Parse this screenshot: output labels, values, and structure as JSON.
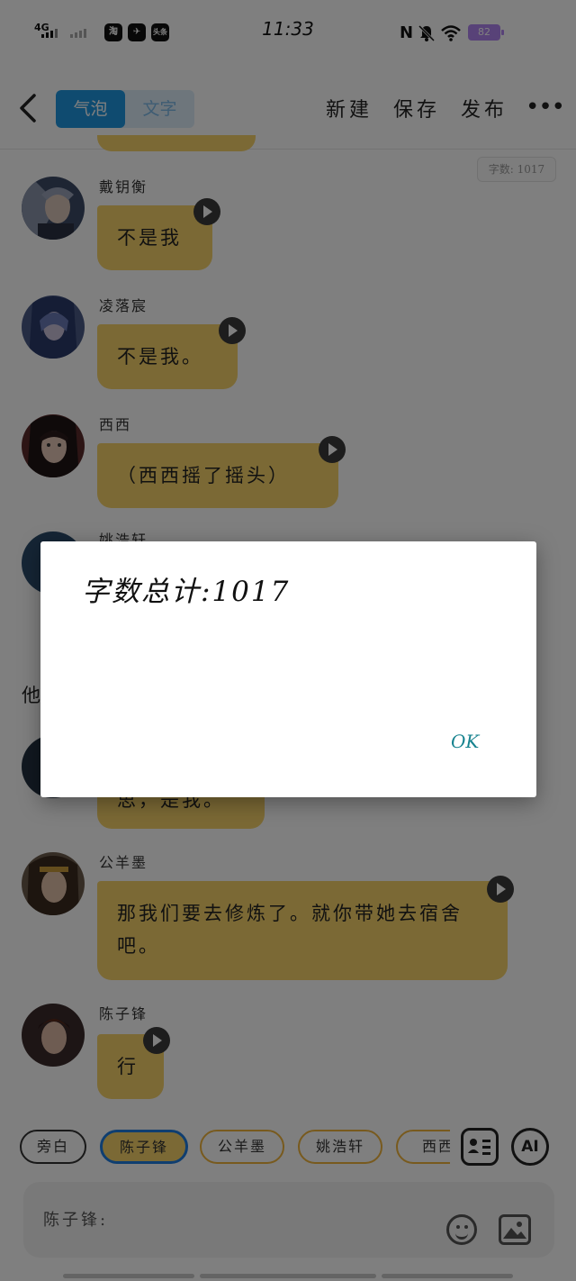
{
  "status_bar": {
    "network": "4G",
    "time": "11:33",
    "battery": "82",
    "apps": [
      "淘",
      "✈",
      "头条"
    ]
  },
  "nav": {
    "back_icon": "chevron-left-icon",
    "tabs": [
      {
        "label": "气泡",
        "active": true
      },
      {
        "label": "文字",
        "active": false
      }
    ],
    "actions": [
      "新建",
      "保存",
      "发布"
    ],
    "more": "•••"
  },
  "word_count_badge": "字数: 1017",
  "messages": [
    {
      "speaker": "戴钥衡",
      "text": "不是我"
    },
    {
      "speaker": "凌落宸",
      "text": "不是我。"
    },
    {
      "speaker": "西西",
      "text": "（西西摇了摇头）"
    },
    {
      "speaker": "姚浩轩",
      "text": ""
    },
    {
      "speaker": "",
      "text": "思，是我。"
    },
    {
      "speaker": "公羊墨",
      "text": "那我们要去修炼了。就你带她去宿舍吧。"
    },
    {
      "speaker": "陈子锋",
      "text": "行"
    }
  ],
  "narration_partial": "他",
  "chips": [
    {
      "label": "旁白",
      "kind": "narrator"
    },
    {
      "label": "陈子锋",
      "kind": "selected"
    },
    {
      "label": "公羊墨",
      "kind": "character"
    },
    {
      "label": "姚浩轩",
      "kind": "character"
    },
    {
      "label": "西西",
      "kind": "character"
    }
  ],
  "tools": {
    "ai_label": "AI",
    "roles_icon": "contact-card-icon"
  },
  "input": {
    "value": "陈子锋:"
  },
  "dialog": {
    "message": "字数总计:1017",
    "ok_label": "OK"
  },
  "colors": {
    "accent": "#1f97e0",
    "bubble": "#f7d36a",
    "ok": "#17838f",
    "chip_border": "#f0b43c"
  }
}
